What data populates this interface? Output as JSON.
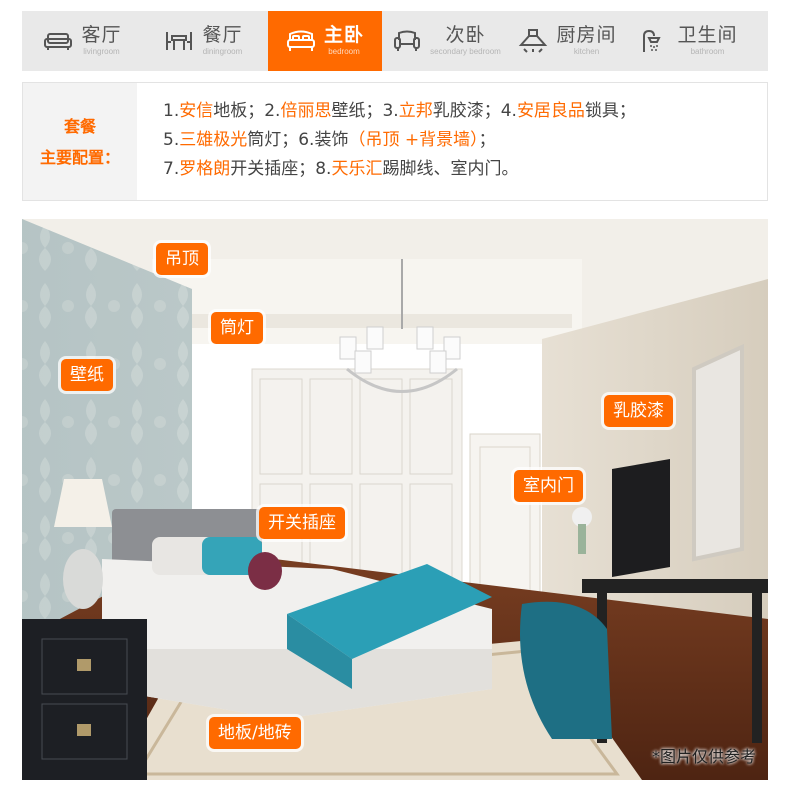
{
  "tabs": [
    {
      "zh": "客厅",
      "en": "livingroom",
      "icon": "sofa-icon"
    },
    {
      "zh": "餐厅",
      "en": "diningroom",
      "icon": "dining-table-icon"
    },
    {
      "zh": "主卧",
      "en": "bedroom",
      "icon": "bed-icon"
    },
    {
      "zh": "次卧",
      "en": "secondary bedroom",
      "icon": "armchair-icon"
    },
    {
      "zh": "厨房间",
      "en": "kitchen",
      "icon": "range-hood-icon"
    },
    {
      "zh": "卫生间",
      "en": "bathroom",
      "icon": "shower-icon"
    }
  ],
  "active_tab": "主卧",
  "package": {
    "label_line1": "套餐",
    "label_line2": "主要配置：",
    "lines": [
      [
        {
          "t": "1."
        },
        {
          "t": "安信",
          "hl": true
        },
        {
          "t": "地板；2."
        },
        {
          "t": "倍丽思",
          "hl": true
        },
        {
          "t": "壁纸；3."
        },
        {
          "t": "立邦",
          "hl": true
        },
        {
          "t": "乳胶漆；4."
        },
        {
          "t": "安居良品",
          "hl": true
        },
        {
          "t": "锁具；"
        }
      ],
      [
        {
          "t": "5."
        },
        {
          "t": "三雄极光",
          "hl": true
        },
        {
          "t": "筒灯；6.装饰"
        },
        {
          "t": "（吊顶 +背景墙）",
          "hl": true
        },
        {
          "t": "；"
        }
      ],
      [
        {
          "t": "7."
        },
        {
          "t": "罗格朗",
          "hl": true
        },
        {
          "t": "开关插座；8."
        },
        {
          "t": "天乐汇",
          "hl": true
        },
        {
          "t": "踢脚线、室内门。"
        }
      ]
    ]
  },
  "photo_tags": {
    "ceiling": "吊顶",
    "downlight": "筒灯",
    "wallpaper": "壁纸",
    "latex_paint": "乳胶漆",
    "interior_door": "室内门",
    "switch_socket": "开关插座",
    "floor": "地板/地砖"
  },
  "disclaimer": "*图片仅供参考",
  "colors": {
    "accent": "#ff6a00",
    "tab_bg": "#e9e9e9",
    "label_bg": "#f3f3f3"
  }
}
